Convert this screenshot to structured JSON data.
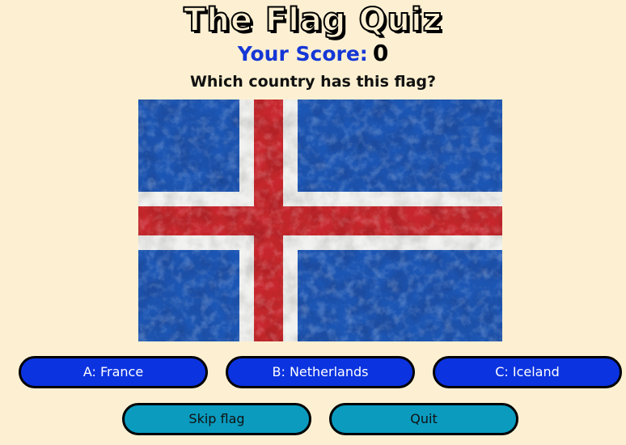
{
  "app": {
    "title": "The Flag Quiz"
  },
  "score": {
    "label": "Your Score:",
    "value": "0"
  },
  "question": {
    "text": "Which country has this flag?",
    "flag": {
      "country": "Iceland",
      "colors": {
        "field": "#1f56b4",
        "cross_border": "#f1f1ef",
        "cross": "#c8282d"
      }
    }
  },
  "answers": [
    {
      "label": "A: France"
    },
    {
      "label": "B: Netherlands"
    },
    {
      "label": "C: Iceland"
    }
  ],
  "controls": {
    "skip_label": "Skip flag",
    "quit_label": "Quit"
  },
  "theme": {
    "background": "#fdf0d2",
    "answer_button": "#0b33e0",
    "control_button": "#0a9bbf",
    "score_label": "#1537d6"
  }
}
